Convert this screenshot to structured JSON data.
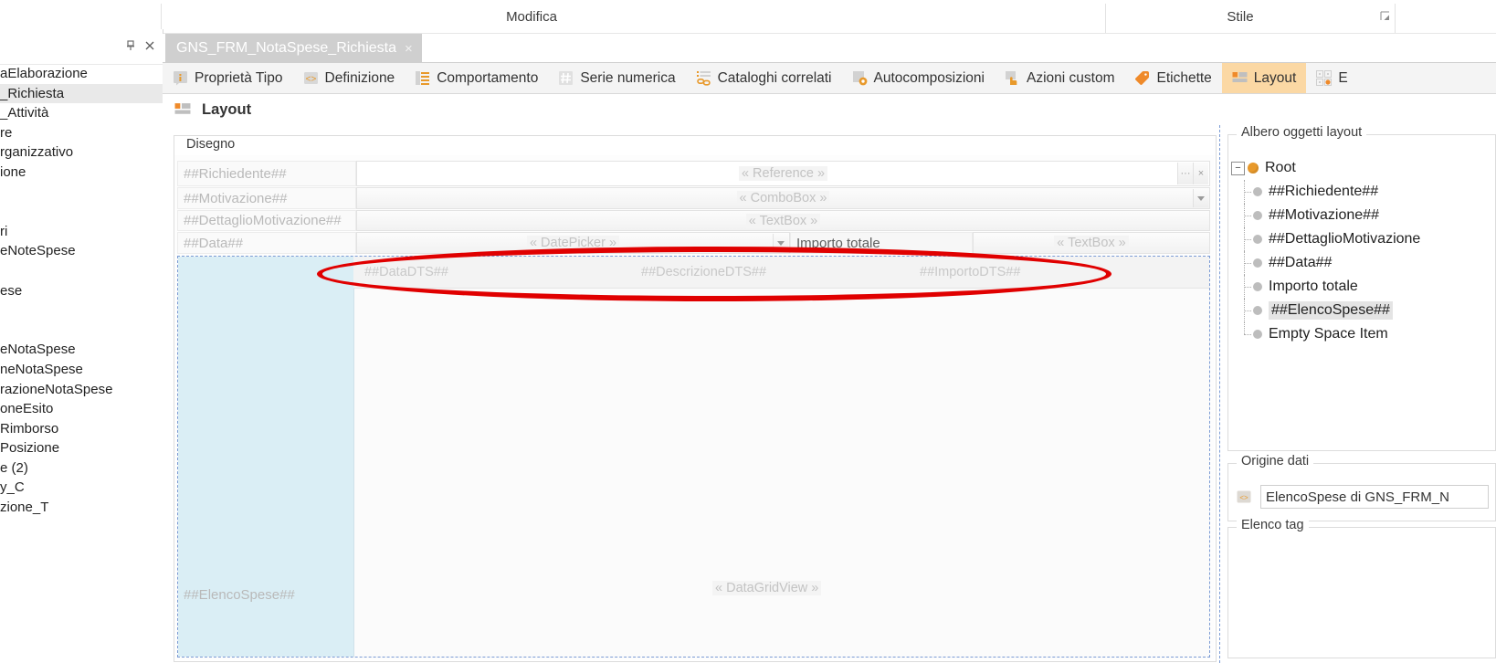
{
  "ribbon": {
    "groups": [
      {
        "label": "Modifica"
      },
      {
        "label": "Stile"
      }
    ],
    "dialog_launcher_icon": "dialog-launcher-icon"
  },
  "left_panel": {
    "pin_icon": "pin-icon",
    "close_icon": "close-icon",
    "items": [
      {
        "label": "aElaborazione",
        "selected": false
      },
      {
        "label": "_Richiesta",
        "selected": true
      },
      {
        "label": "_Attività",
        "selected": false
      },
      {
        "label": "re",
        "selected": false
      },
      {
        "label": "rganizzativo",
        "selected": false
      },
      {
        "label": "ione",
        "selected": false
      },
      {
        "label": "",
        "selected": false
      },
      {
        "label": "",
        "selected": false
      },
      {
        "label": "ri",
        "selected": false
      },
      {
        "label": "eNoteSpese",
        "selected": false
      },
      {
        "label": "",
        "selected": false
      },
      {
        "label": "ese",
        "selected": false
      },
      {
        "label": "",
        "selected": false
      },
      {
        "label": "",
        "selected": false
      },
      {
        "label": "eNotaSpese",
        "selected": false
      },
      {
        "label": "neNotaSpese",
        "selected": false
      },
      {
        "label": "razioneNotaSpese",
        "selected": false
      },
      {
        "label": "oneEsito",
        "selected": false
      },
      {
        "label": "Rimborso",
        "selected": false
      },
      {
        "label": "Posizione",
        "selected": false
      },
      {
        "label": "e (2)",
        "selected": false
      },
      {
        "label": "y_C",
        "selected": false
      },
      {
        "label": "zione_T",
        "selected": false
      }
    ]
  },
  "document_tab": {
    "title": "GNS_FRM_NotaSpese_Richiesta",
    "close_label": "×",
    "close_icon": "close-icon"
  },
  "inner_tabs": [
    {
      "label": "Proprietà Tipo",
      "icon": "info-icon",
      "active": false
    },
    {
      "label": "Definizione",
      "icon": "code-icon",
      "active": false
    },
    {
      "label": "Comportamento",
      "icon": "list-icon",
      "active": false
    },
    {
      "label": "Serie numerica",
      "icon": "hash-icon",
      "active": false
    },
    {
      "label": "Cataloghi correlati",
      "icon": "link-list-icon",
      "active": false
    },
    {
      "label": "Autocomposizioni",
      "icon": "wizard-icon",
      "active": false
    },
    {
      "label": "Azioni custom",
      "icon": "hand-click-icon",
      "active": false
    },
    {
      "label": "Etichette",
      "icon": "tag-icon",
      "active": false
    },
    {
      "label": "Layout",
      "icon": "layout-icon",
      "active": true
    },
    {
      "label": "E",
      "icon": "grid-dots-icon",
      "active": false
    }
  ],
  "page_header": {
    "title": "Layout",
    "icon": "layout-icon"
  },
  "design": {
    "group_caption": "Disegno",
    "rows": [
      {
        "label": "##Richiedente##",
        "placeholder": "« Reference »",
        "control": "reference",
        "ellipsis_label": "···",
        "close_label": "×"
      },
      {
        "label": "##Motivazione##",
        "placeholder": "« ComboBox »",
        "control": "combobox"
      },
      {
        "label": "##DettaglioMotivazione##",
        "placeholder": "« TextBox »",
        "control": "textbox"
      },
      {
        "label": "##Data##",
        "placeholder": "« DatePicker »",
        "control": "datepicker"
      }
    ],
    "importo_totale_label": "Importo totale",
    "importo_totale_placeholder": "« TextBox »",
    "grid": {
      "label": "##ElencoSpese##",
      "placeholder": "« DataGridView »",
      "columns": [
        "##DataDTS##",
        "##DescrizioneDTS##",
        "##ImportoDTS##"
      ]
    }
  },
  "right_rail": {
    "tree_caption": "Albero oggetti layout",
    "root": {
      "label": "Root",
      "expander": "−"
    },
    "nodes": [
      {
        "label": "##Richiedente##",
        "selected": false
      },
      {
        "label": "##Motivazione##",
        "selected": false
      },
      {
        "label": "##DettaglioMotivazione",
        "selected": false
      },
      {
        "label": "##Data##",
        "selected": false
      },
      {
        "label": "Importo totale",
        "selected": false
      },
      {
        "label": "##ElencoSpese##",
        "selected": true
      },
      {
        "label": "Empty Space Item",
        "selected": false
      }
    ],
    "datasource": {
      "caption": "Origine dati",
      "value": "ElencoSpese di GNS_FRM_N",
      "icon": "datasource-icon"
    },
    "tags": {
      "caption": "Elenco tag"
    }
  },
  "annotation": {
    "shape": "ellipse",
    "color": "#e00000"
  },
  "colors": {
    "accent": "#e8992b",
    "active_tab_bg": "#fbd8a4",
    "selection_blue": "#daeef5",
    "annotation_red": "#e00000"
  }
}
